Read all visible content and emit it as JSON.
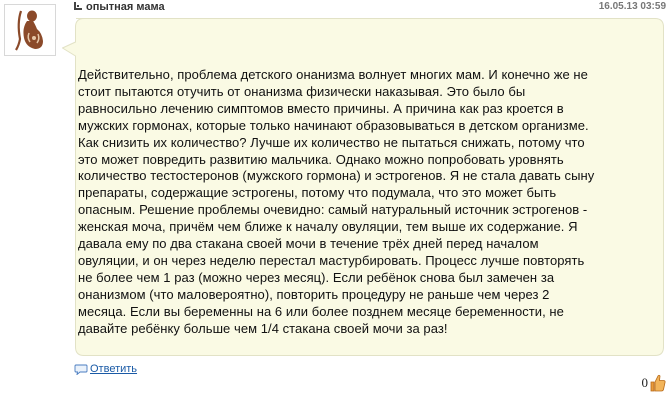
{
  "comment": {
    "author": "опытная мама",
    "date": "16.05.13 03:59",
    "text_lines": [
      "Действительно, проблема детского онанизма волнует многих мам. И конечно же не",
      "стоит пытаются отучить от онанизма физически наказывая. Это было бы",
      "равносильно лечению симптомов вместо причины. А причина как раз кроется в",
      "мужских гормонах, которые только начинают образовываться в детском организме.",
      "Как снизить их количество? Лучше их количество не пытаться снижать, потому что",
      "это может повредить развитию мальчика. Однако можно попробовать уровнять",
      "количество тестостеронов (мужского гормона) и эстрогенов. Я не стала давать сыну",
      "препараты, содержащие эстрогены, потому что подумала, что это может быть",
      "опасным. Решение проблемы очевидно: самый натуральный источник эстрогенов -",
      "женская моча, причём чем ближе к началу овуляции, тем выше их содержание. Я",
      "давала ему по два стакана своей мочи в течение трёх дней перед началом",
      "овуляции, и он через неделю перестал мастурбировать. Процесс лучше повторять",
      "не более чем 1 раз (можно через месяц). Если ребёнок снова был замечен за",
      "онанизмом (что маловероятно), повторить процедуру не раньше чем через 2",
      "месяца. Если вы беременны на 6 или более позднем месяце беременности, не",
      "давайте ребёнку больше чем 1/4 стакана своей мочи за раз!"
    ],
    "reply_label": "Ответить",
    "rating_count": "0"
  },
  "icons": {
    "user": "user-icon",
    "reply": "speech-bubble-icon",
    "like": "thumbs-up-icon"
  },
  "colors": {
    "bubble_fill": "#fafae4",
    "bubble_border": "#e2e2c6",
    "link": "#1a5aa6"
  }
}
